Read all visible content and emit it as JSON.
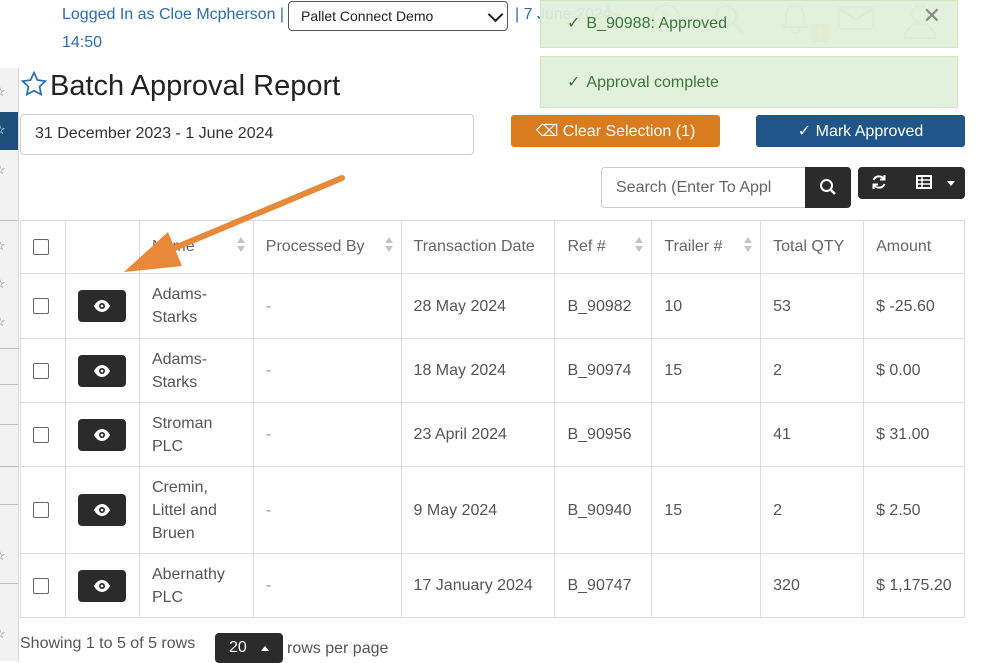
{
  "header": {
    "logged_in_text": "Logged In as Cloe Mcpherson |",
    "time": "14:50",
    "company_select_value": "Pallet Connect Demo",
    "date_fragment": "| 7 June 2024"
  },
  "toasts": [
    {
      "text": "B_90988: Approved"
    },
    {
      "text": "Approval complete"
    }
  ],
  "page": {
    "title": "Batch Approval Report",
    "date_range": "31 December 2023 - 1 June 2024"
  },
  "toolbar": {
    "clear_selection_label": "Clear Selection (1)",
    "mark_approved_label": "Mark Approved",
    "search_placeholder": "Search (Enter To Appl"
  },
  "notification_badge": "1",
  "table": {
    "columns": [
      "Name",
      "Processed By",
      "Transaction Date",
      "Ref #",
      "Trailer #",
      "Total QTY",
      "Amount"
    ],
    "rows": [
      {
        "name": "Adams-Starks",
        "processed_by": "-",
        "date": "28 May 2024",
        "ref": "B_90982",
        "trailer": "10",
        "qty": "53",
        "amount": "$ -25.60"
      },
      {
        "name": "Adams-Starks",
        "processed_by": "-",
        "date": "18 May 2024",
        "ref": "B_90974",
        "trailer": "15",
        "qty": "2",
        "amount": "$ 0.00"
      },
      {
        "name": "Stroman PLC",
        "processed_by": "-",
        "date": "23 April 2024",
        "ref": "B_90956",
        "trailer": "",
        "qty": "41",
        "amount": "$ 31.00"
      },
      {
        "name": "Cremin, Littel and Bruen",
        "processed_by": "-",
        "date": "9 May 2024",
        "ref": "B_90940",
        "trailer": "15",
        "qty": "2",
        "amount": "$ 2.50"
      },
      {
        "name": "Abernathy PLC",
        "processed_by": "-",
        "date": "17 January 2024",
        "ref": "B_90747",
        "trailer": "",
        "qty": "320",
        "amount": "$ 1,175.20"
      }
    ]
  },
  "footer": {
    "showing": "Showing 1 to 5 of 5 rows",
    "page_size": "20",
    "rows_per_page": "rows per page"
  },
  "colors": {
    "accent_orange": "#d97b1f",
    "primary_blue": "#1f5588",
    "toast_green": "#dff0d8",
    "dark_button": "#2b2b2b",
    "annotation_arrow": "#e8893a"
  }
}
